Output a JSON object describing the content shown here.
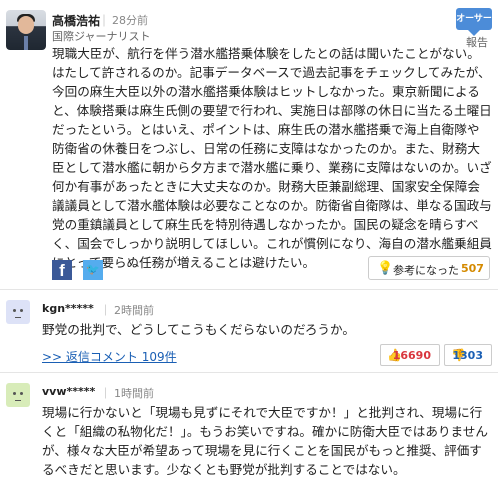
{
  "main": {
    "author": "高橋浩祐",
    "separator": "｜",
    "time": "28分前",
    "title": "国際ジャーナリスト",
    "owner_badge": "オーサー",
    "report": "報告",
    "text": "現職大臣が、航行を伴う潜水艦搭乗体験をしたとの話は聞いたことがない。はたして許されるのか。記事データベースで過去記事をチェックしてみたが、今回の麻生大臣以外の潜水艦搭乗体験はヒットしなかった。東京新聞によると、体験搭乗は麻生氏側の要望で行われ、実施日は部隊の休日に当たる土曜日だったという。とはいえ、ポイントは、麻生氏の潜水艦搭乗で海上自衛隊や防衛省の休養日をつぶし、日常の任務に支障はなかったのか。また、財務大臣として潜水艦に朝から夕方まで潜水艦に乗り、業務に支障はないのか。いざ何か有事があったときに大丈夫なのか。財務大臣兼副総理、国家安全保障会議議員として潜水艦体験は必要なことなのか。防衛省自衛隊は、単なる国政与党の重鎮議員として麻生氏を特別待遇しなかったか。国民の疑念を晴らすべく、国会でしっかり説明してほしい。これが慣例になり、海自の潜水艦乗組員にとって要らぬ任務が増えることは避けたい。",
    "share_facebook": "f",
    "share_twitter": "🐦",
    "helpful_label": "参考になった",
    "helpful_count": "507"
  },
  "replies": [
    {
      "user": "kgn*****",
      "separator": "｜",
      "time": "2時間前",
      "text": "野党の批判で、どうしてこうもくだらないのだろうか。",
      "replies_link": ">> 返信コメント 109件",
      "likes": "16690",
      "dislikes": "1303",
      "avatar_color": "#dde2f7"
    },
    {
      "user": "vvw*****",
      "separator": "｜",
      "time": "1時間前",
      "text": "現場に行かないと「現場も見ずにそれで大臣ですか！」と批判され、現場に行くと「組織の私物化だ！」。もうお笑いですね。確かに防衛大臣ではありませんが、様々な大臣が希望あって現場を見に行くことを国民がもっと推奨、評価するべきだと思います。少なくとも野党が批判することではない。",
      "avatar_color": "#d8ecb9"
    }
  ],
  "colors": {
    "link": "#1a5fb4",
    "like": "#d9363e",
    "dislike": "#1a5fb4",
    "badge": "#4c8cd8"
  }
}
